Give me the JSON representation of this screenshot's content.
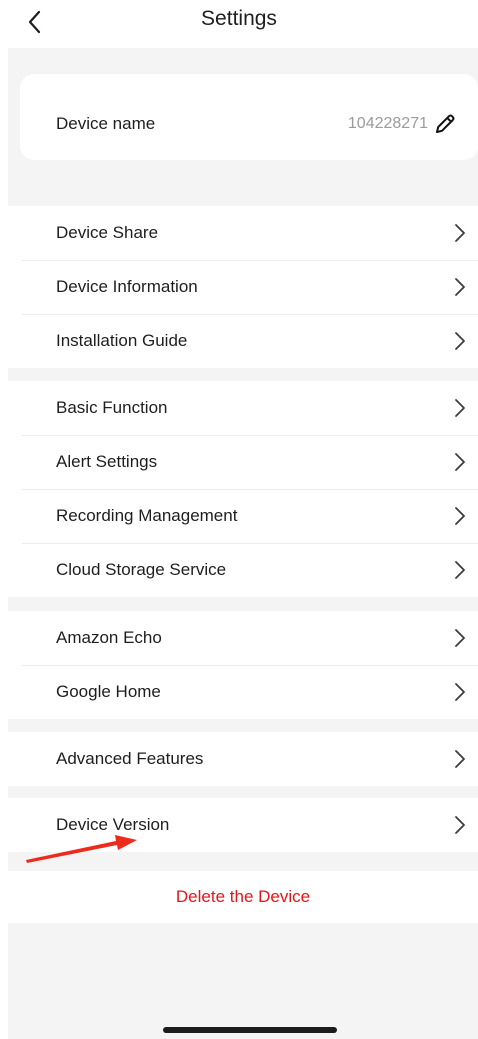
{
  "header": {
    "title": "Settings"
  },
  "device_name": {
    "label": "Device name",
    "value": "104228271"
  },
  "groups": [
    {
      "items": [
        {
          "label": "Device Share"
        },
        {
          "label": "Device Information"
        },
        {
          "label": "Installation Guide"
        }
      ]
    },
    {
      "items": [
        {
          "label": "Basic Function"
        },
        {
          "label": "Alert Settings"
        },
        {
          "label": "Recording Management"
        },
        {
          "label": "Cloud Storage Service"
        }
      ]
    },
    {
      "items": [
        {
          "label": "Amazon Echo"
        },
        {
          "label": "Google Home"
        }
      ]
    },
    {
      "items": [
        {
          "label": "Advanced Features"
        }
      ]
    },
    {
      "items": [
        {
          "label": "Device Version"
        }
      ]
    }
  ],
  "delete": {
    "label": "Delete the Device",
    "color": "#e8141b"
  },
  "colors": {
    "background": "#f4f4f5",
    "card": "#ffffff",
    "annotation_arrow": "#ee2a1c"
  },
  "icons": {
    "back": "chevron-left-icon",
    "edit": "pencil-icon",
    "row": "chevron-right-icon"
  }
}
